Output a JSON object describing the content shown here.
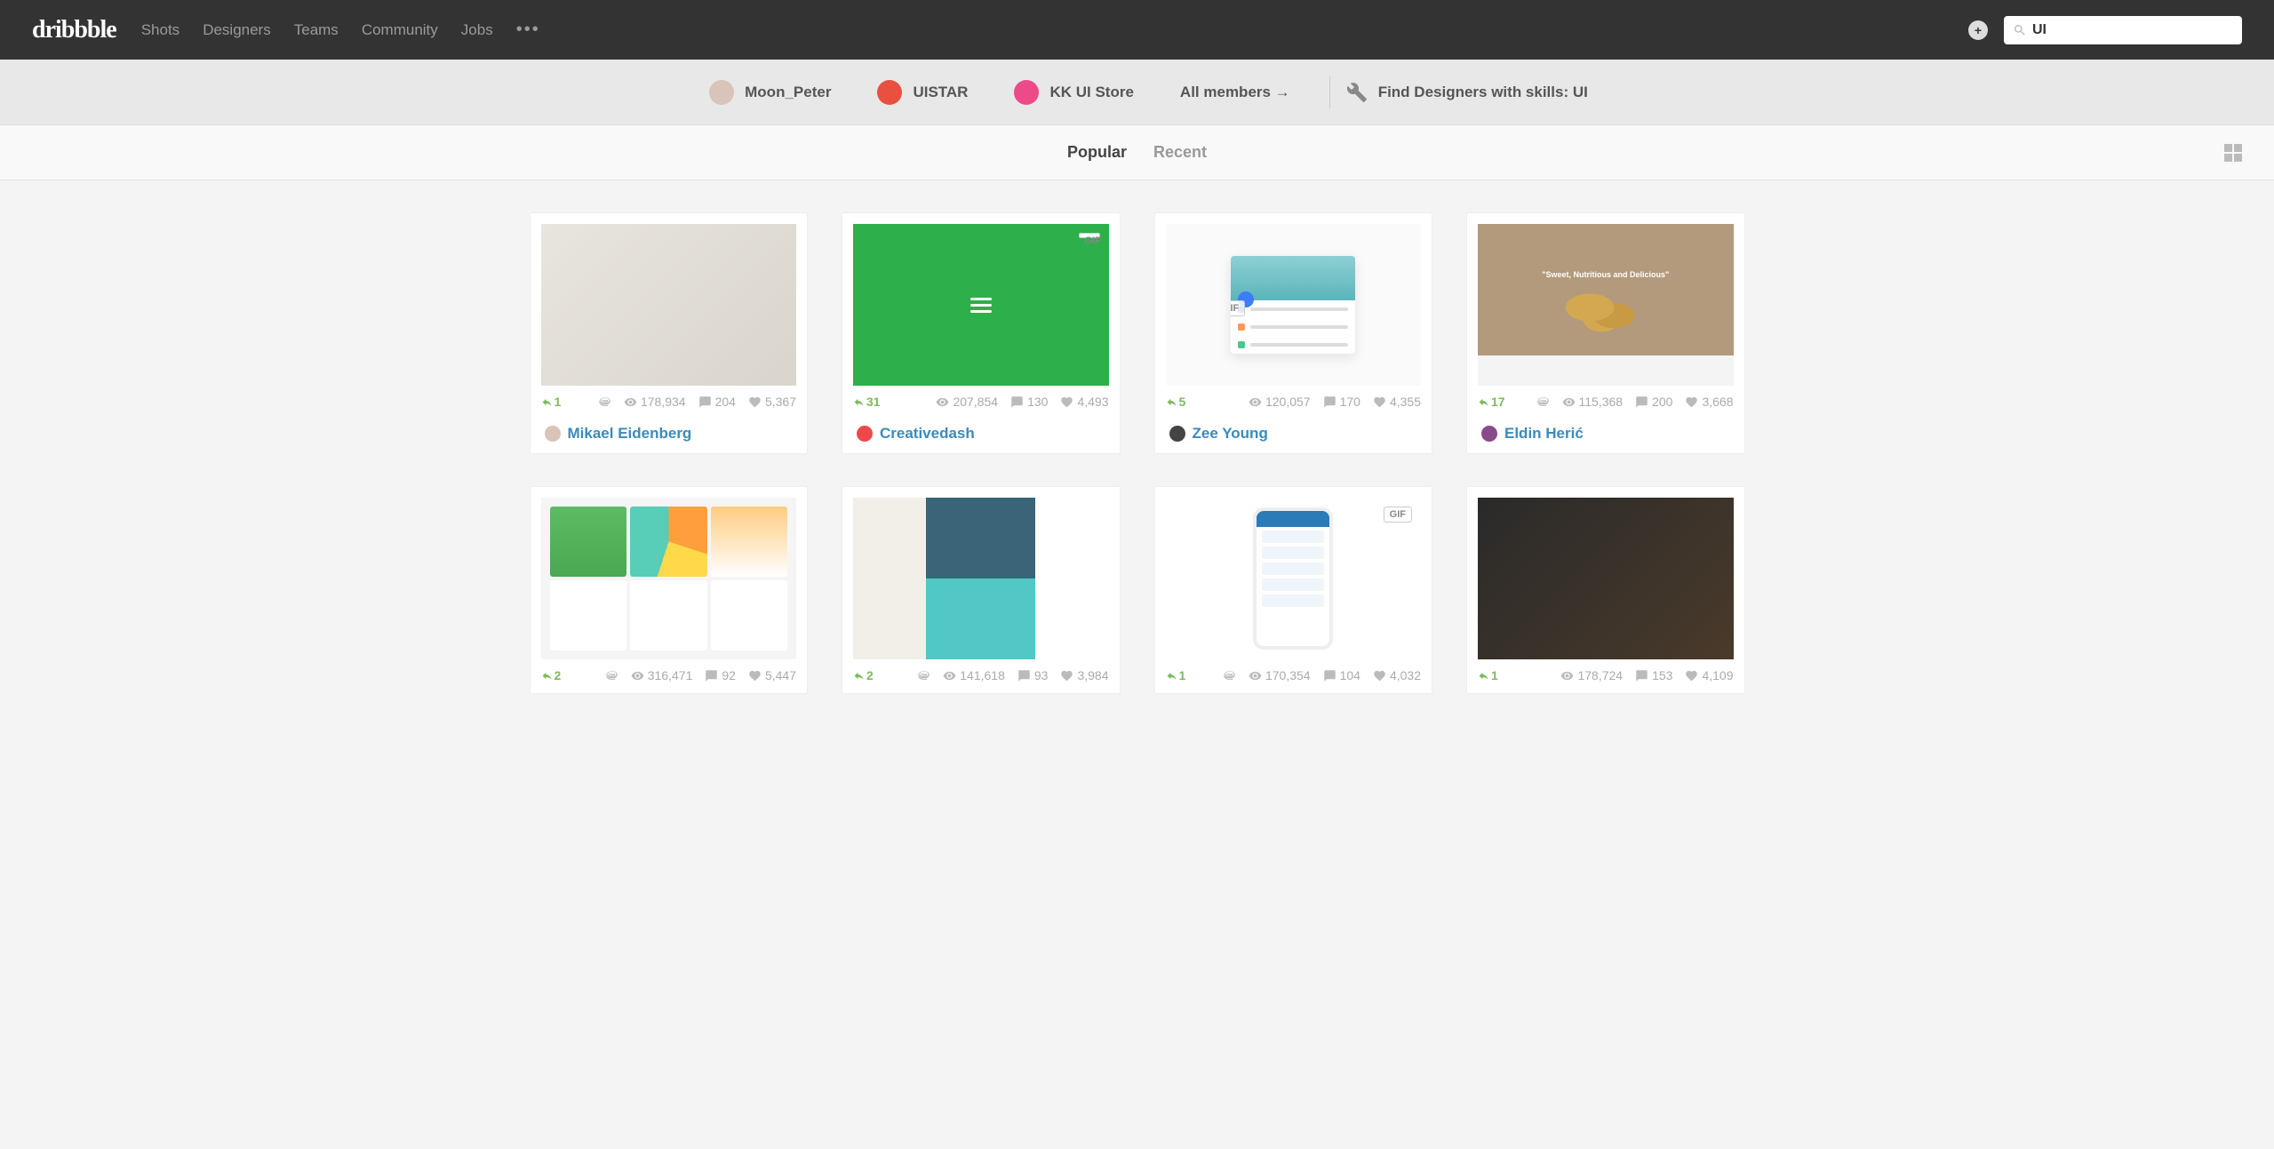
{
  "header": {
    "logo": "dribbble",
    "nav": [
      "Shots",
      "Designers",
      "Teams",
      "Community",
      "Jobs"
    ],
    "search_value": "UI",
    "user_badge": "+"
  },
  "subnav": {
    "designers": [
      {
        "name": "Moon_Peter",
        "color": "#d8c4b8"
      },
      {
        "name": "UISTAR",
        "color": "#e85040"
      },
      {
        "name": "KK UI Store",
        "color": "#ec4a89"
      }
    ],
    "all_members": "All members →",
    "skill_link": "Find Designers with skills: UI"
  },
  "filter": {
    "popular": "Popular",
    "recent": "Recent"
  },
  "shots": [
    {
      "thumb": "peel",
      "gif": false,
      "rebounds": "1",
      "attach": true,
      "views": "178,934",
      "comments": "204",
      "likes": "5,367",
      "author": "Mikael Eidenberg",
      "author_color": "#d8c4b8"
    },
    {
      "thumb": "green",
      "gif": true,
      "rebounds": "31",
      "attach": false,
      "views": "207,854",
      "comments": "130",
      "likes": "4,493",
      "author": "Creativedash",
      "author_color": "#ec4a4a"
    },
    {
      "thumb": "material",
      "gif": true,
      "rebounds": "5",
      "attach": false,
      "views": "120,057",
      "comments": "170",
      "likes": "4,355",
      "author": "Zee Young",
      "author_color": "#444"
    },
    {
      "thumb": "potato",
      "gif": false,
      "rebounds": "17",
      "attach": true,
      "views": "115,368",
      "comments": "200",
      "likes": "3,668",
      "author": "Eldin Herić",
      "author_color": "#8a4a8a"
    },
    {
      "thumb": "dashboard",
      "gif": false,
      "rebounds": "2",
      "attach": true,
      "views": "316,471",
      "comments": "92",
      "likes": "5,447",
      "author": "",
      "author_color": ""
    },
    {
      "thumb": "pairs",
      "gif": false,
      "rebounds": "2",
      "attach": true,
      "views": "141,618",
      "comments": "93",
      "likes": "3,984",
      "author": "",
      "author_color": ""
    },
    {
      "thumb": "friends",
      "gif": true,
      "rebounds": "1",
      "attach": true,
      "views": "170,354",
      "comments": "104",
      "likes": "4,032",
      "author": "",
      "author_color": ""
    },
    {
      "thumb": "finger",
      "gif": false,
      "rebounds": "1",
      "attach": false,
      "views": "178,724",
      "comments": "153",
      "likes": "4,109",
      "author": "",
      "author_color": ""
    }
  ],
  "gif_label": "GIF"
}
